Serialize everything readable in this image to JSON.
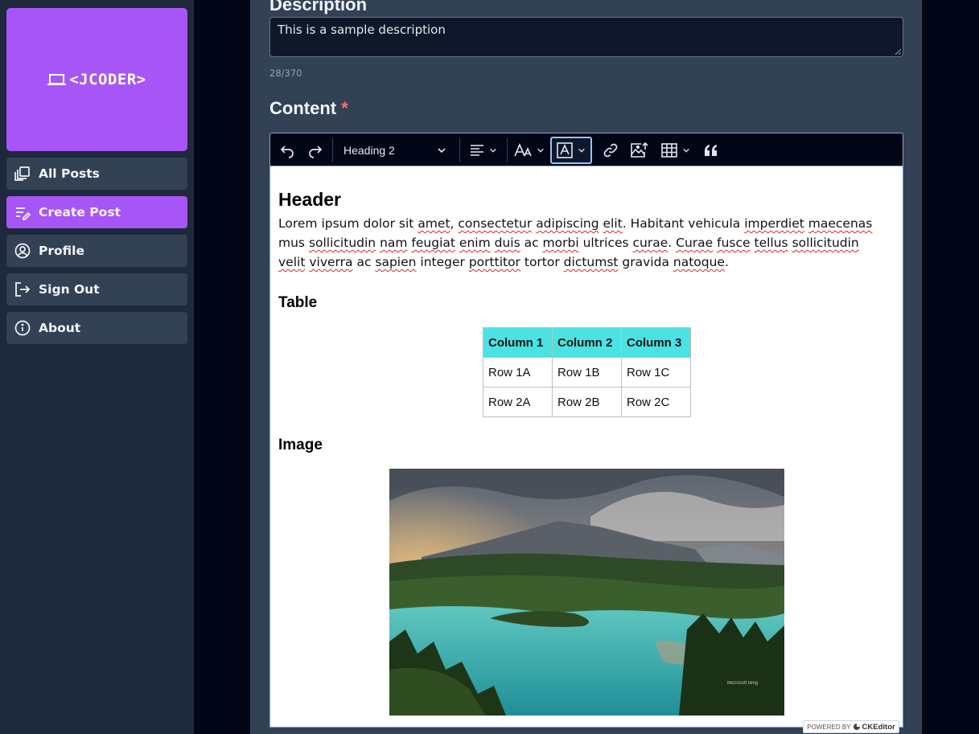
{
  "brand": {
    "logo_text": "<JCODER>",
    "logo_icon": "laptop-icon"
  },
  "sidebar": {
    "items": [
      {
        "label": "All Posts",
        "icon": "posts-stack-icon",
        "active": false
      },
      {
        "label": "Create Post",
        "icon": "edit-list-icon",
        "active": true
      },
      {
        "label": "Profile",
        "icon": "user-circle-icon",
        "active": false
      },
      {
        "label": "Sign Out",
        "icon": "sign-out-icon",
        "active": false
      },
      {
        "label": "About",
        "icon": "info-icon",
        "active": false
      }
    ]
  },
  "form": {
    "description_label": "Description",
    "description_value": "This is a sample description",
    "char_count": "28/370",
    "content_label": "Content",
    "required_mark": "*"
  },
  "editor": {
    "toolbar": {
      "heading_value": "Heading 2",
      "buttons": [
        "undo-icon",
        "redo-icon",
        "align-icon",
        "font-size-icon",
        "font-color-icon",
        "link-icon",
        "insert-image-icon",
        "table-icon",
        "blockquote-icon"
      ]
    },
    "body": {
      "h2": "Header",
      "paragraph": {
        "w1": "Lorem ipsum dolor sit ",
        "w2": "amet",
        "w3": ", ",
        "w4": "consectetur",
        "w5": " ",
        "w6": "adipiscing",
        "w7": " ",
        "w8": "elit",
        "w9": ". Habitant vehicula ",
        "w10": "imperdiet",
        "w11": " ",
        "w12": "maecenas",
        "w13": " mus ",
        "w14": "sollicitudin",
        "w15": " ",
        "w16": "nam",
        "w17": " ",
        "w18": "feugiat",
        "w19": " ",
        "w20": "enim",
        "w21": " ",
        "w22": "duis",
        "w23": " ac ",
        "w24": "morbi",
        "w25": " ultrices ",
        "w26": "curae",
        "w27": ". ",
        "w28": "Curae",
        "w29": " ",
        "w30": "fusce",
        "w31": " ",
        "w32": "tellus",
        "w33": " ",
        "w34": "sollicitudin",
        "w35": " ",
        "w36": "velit",
        "w37": " ",
        "w38": "viverra",
        "w39": " ac ",
        "w40": "sapien",
        "w41": " integer ",
        "w42": "porttitor",
        "w43": " tortor ",
        "w44": "dictumst",
        "w45": " gravida ",
        "w46": "natoque",
        "w47": "."
      },
      "table_heading": "Table",
      "table": {
        "headers": [
          "Column 1",
          "Column 2",
          "Column 3"
        ],
        "rows": [
          [
            "Row 1A",
            "Row 1B",
            "Row 1C"
          ],
          [
            "Row 2A",
            "Row 2B",
            "Row 2C"
          ]
        ]
      },
      "image_heading": "Image",
      "image_watermark": "Microsoft Bing"
    },
    "powered_by": "POWERED BY",
    "powered_brand": "CKEditor"
  }
}
